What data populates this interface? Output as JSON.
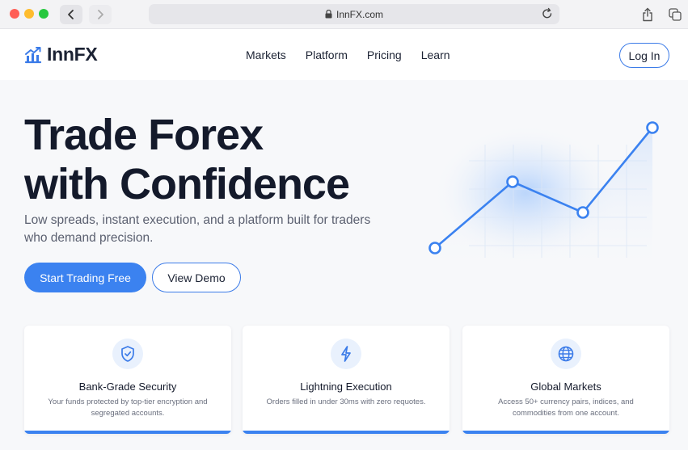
{
  "browser": {
    "url": "InnFX.com"
  },
  "header": {
    "brand": "InnFX",
    "nav": [
      "Markets",
      "Platform",
      "Pricing",
      "Learn"
    ],
    "login_label": "Log In"
  },
  "hero": {
    "title_line1": "Trade Forex",
    "title_line2": "with Confidence",
    "subtitle": "Low spreads, instant execution, and a platform built for traders who demand precision.",
    "primary_cta": "Start Trading Free",
    "secondary_cta": "View Demo"
  },
  "features": [
    {
      "icon": "shield-check-icon",
      "title": "Bank-Grade Security",
      "desc": "Your funds protected by top-tier encryption and segregated accounts."
    },
    {
      "icon": "lightning-icon",
      "title": "Lightning Execution",
      "desc": "Orders filled in under 30ms with zero requotes."
    },
    {
      "icon": "globe-icon",
      "title": "Global Markets",
      "desc": "Access 50+ currency pairs, indices, and commodities from one account."
    }
  ],
  "colors": {
    "accent": "#3b82f0",
    "text_dark": "#141a2b",
    "background": "#f7f8fa"
  }
}
